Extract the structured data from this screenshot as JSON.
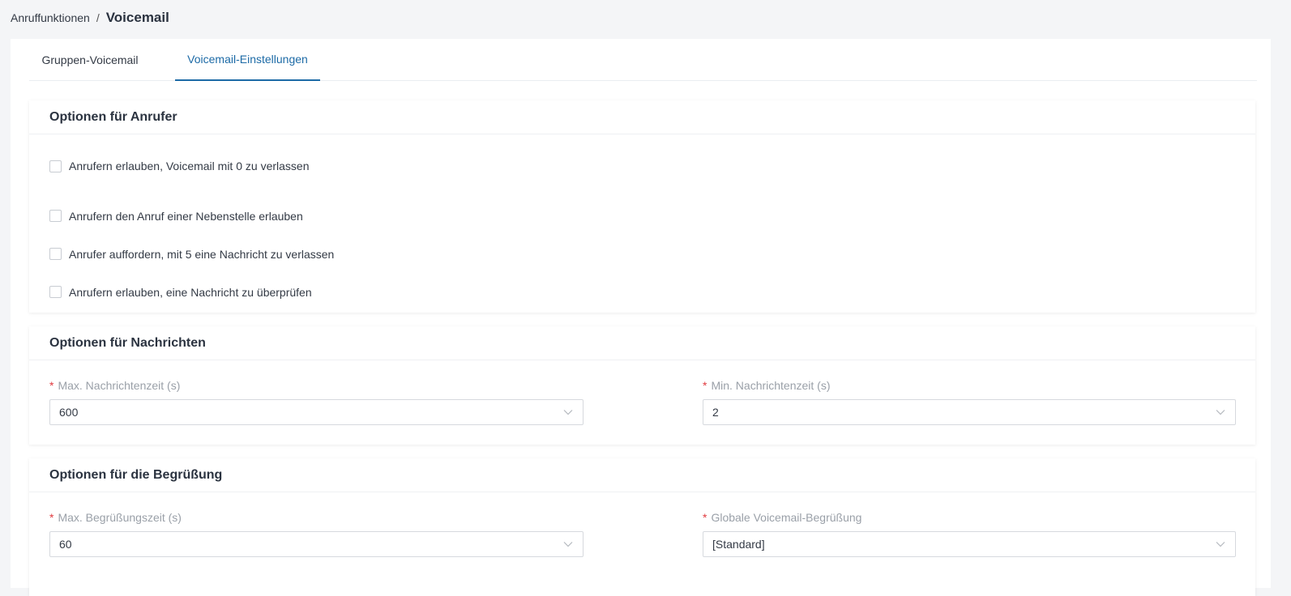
{
  "breadcrumb": {
    "parent": "Anruffunktionen",
    "separator": "/",
    "current": "Voicemail"
  },
  "tabs": [
    {
      "label": "Gruppen-Voicemail",
      "active": false
    },
    {
      "label": "Voicemail-Einstellungen",
      "active": true
    }
  ],
  "caller_options": {
    "title": "Optionen für Anrufer",
    "items": [
      {
        "label": "Anrufern erlauben, Voicemail mit 0 zu verlassen",
        "checked": false
      },
      {
        "label": "Anrufern den Anruf einer Nebenstelle erlauben",
        "checked": false
      },
      {
        "label": "Anrufer auffordern, mit 5 eine Nachricht zu verlassen",
        "checked": false
      },
      {
        "label": "Anrufern erlauben, eine Nachricht zu überprüfen",
        "checked": false
      }
    ]
  },
  "message_options": {
    "title": "Optionen für Nachrichten",
    "max_time": {
      "label": "Max. Nachrichtenzeit (s)",
      "value": "600"
    },
    "min_time": {
      "label": "Min. Nachrichtenzeit (s)",
      "value": "2"
    }
  },
  "greeting_options": {
    "title": "Optionen für die Begrüßung",
    "max_time": {
      "label": "Max. Begrüßungszeit (s)",
      "value": "60"
    },
    "global_greeting": {
      "label": "Globale Voicemail-Begrüßung",
      "value": "[Standard]"
    }
  },
  "required_marker": "*",
  "icons": {
    "select": "chevron-down-icon"
  },
  "colors": {
    "accent": "#1c6aa6",
    "required": "#e0393e"
  }
}
